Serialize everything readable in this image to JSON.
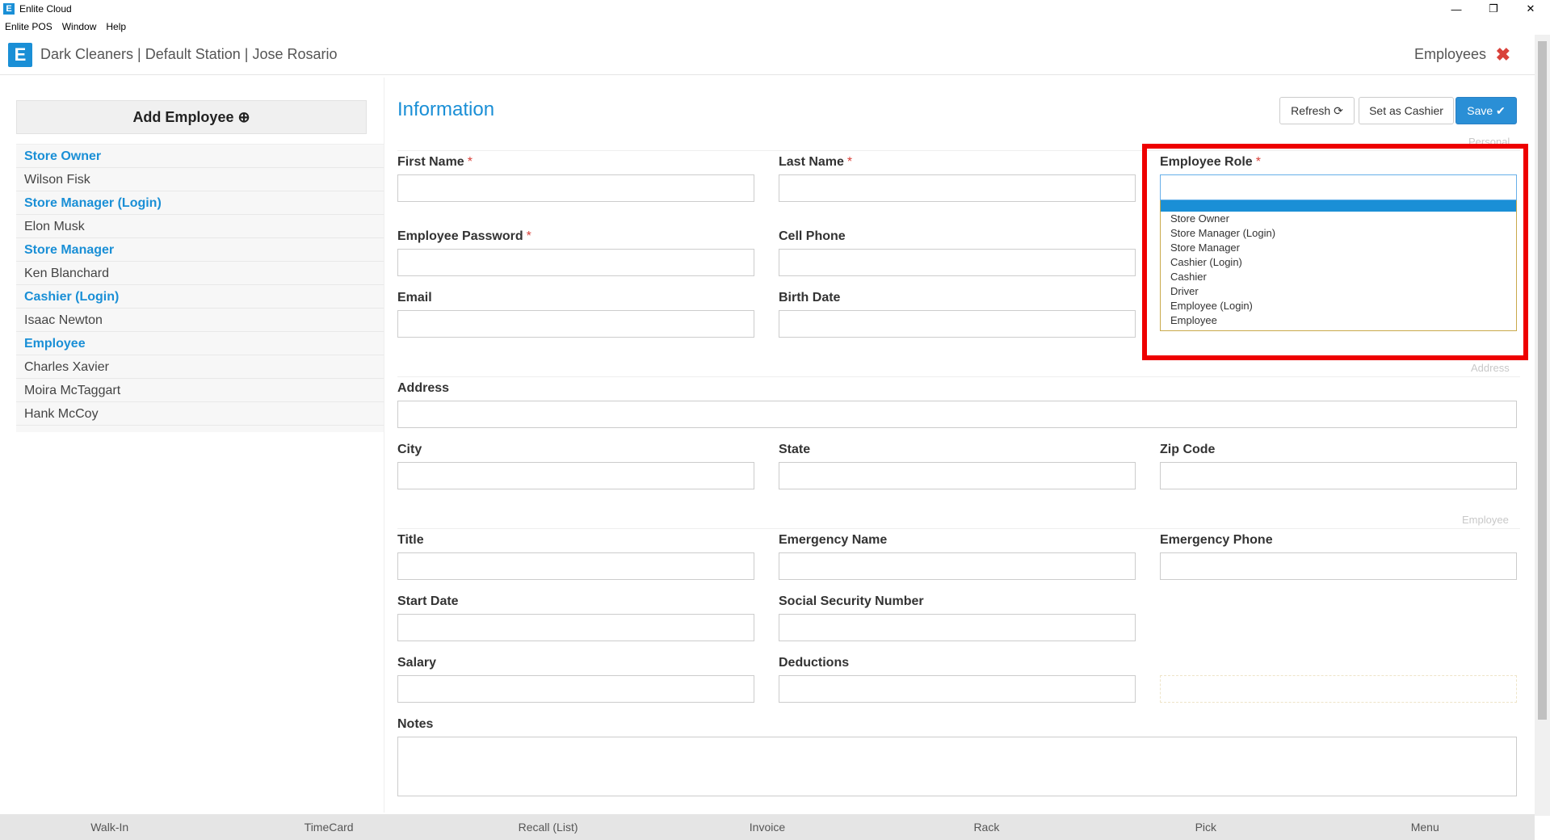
{
  "window": {
    "title": "Enlite Cloud",
    "controls": [
      "—",
      "❐",
      "✕"
    ]
  },
  "menu": [
    "Enlite POS",
    "Window",
    "Help"
  ],
  "header": {
    "breadcrumb": "Dark Cleaners | Default Station | Jose Rosario",
    "section": "Employees",
    "close": "✖"
  },
  "left": {
    "add_button": "Add Employee ⊕",
    "list": [
      {
        "text": "Store Owner",
        "kind": "group"
      },
      {
        "text": "Wilson Fisk",
        "kind": "item"
      },
      {
        "text": "Store Manager (Login)",
        "kind": "group"
      },
      {
        "text": "Elon Musk",
        "kind": "item"
      },
      {
        "text": "Store Manager",
        "kind": "group"
      },
      {
        "text": "Ken Blanchard",
        "kind": "item"
      },
      {
        "text": "Cashier (Login)",
        "kind": "group"
      },
      {
        "text": "Isaac Newton",
        "kind": "item"
      },
      {
        "text": "Employee",
        "kind": "group"
      },
      {
        "text": "Charles Xavier",
        "kind": "item"
      },
      {
        "text": "Moira McTaggart",
        "kind": "item"
      },
      {
        "text": "Hank McCoy",
        "kind": "item"
      }
    ]
  },
  "form": {
    "title": "Information",
    "buttons": {
      "refresh": "Refresh ⟳",
      "cashier": "Set as Cashier",
      "save": "Save ✔"
    },
    "sections": {
      "personal": "Personal",
      "address": "Address",
      "employee": "Employee"
    },
    "labels": {
      "first_name": "First Name",
      "last_name": "Last Name",
      "employee_role": "Employee Role",
      "password": "Employee Password",
      "cell_phone": "Cell Phone",
      "email": "Email",
      "birth_date": "Birth Date",
      "address": "Address",
      "city": "City",
      "state": "State",
      "zip": "Zip Code",
      "title": "Title",
      "emergency_name": "Emergency Name",
      "emergency_phone": "Emergency Phone",
      "start_date": "Start Date",
      "ssn": "Social Security Number",
      "salary": "Salary",
      "deductions": "Deductions",
      "notes": "Notes"
    },
    "required_mark": "*",
    "role_options": [
      "Store Owner",
      "Store Manager (Login)",
      "Store Manager",
      "Cashier (Login)",
      "Cashier",
      "Driver",
      "Employee (Login)",
      "Employee"
    ]
  },
  "bottom": [
    "Walk-In",
    "TimeCard",
    "Recall (List)",
    "Invoice",
    "Rack",
    "Pick",
    "Menu"
  ]
}
